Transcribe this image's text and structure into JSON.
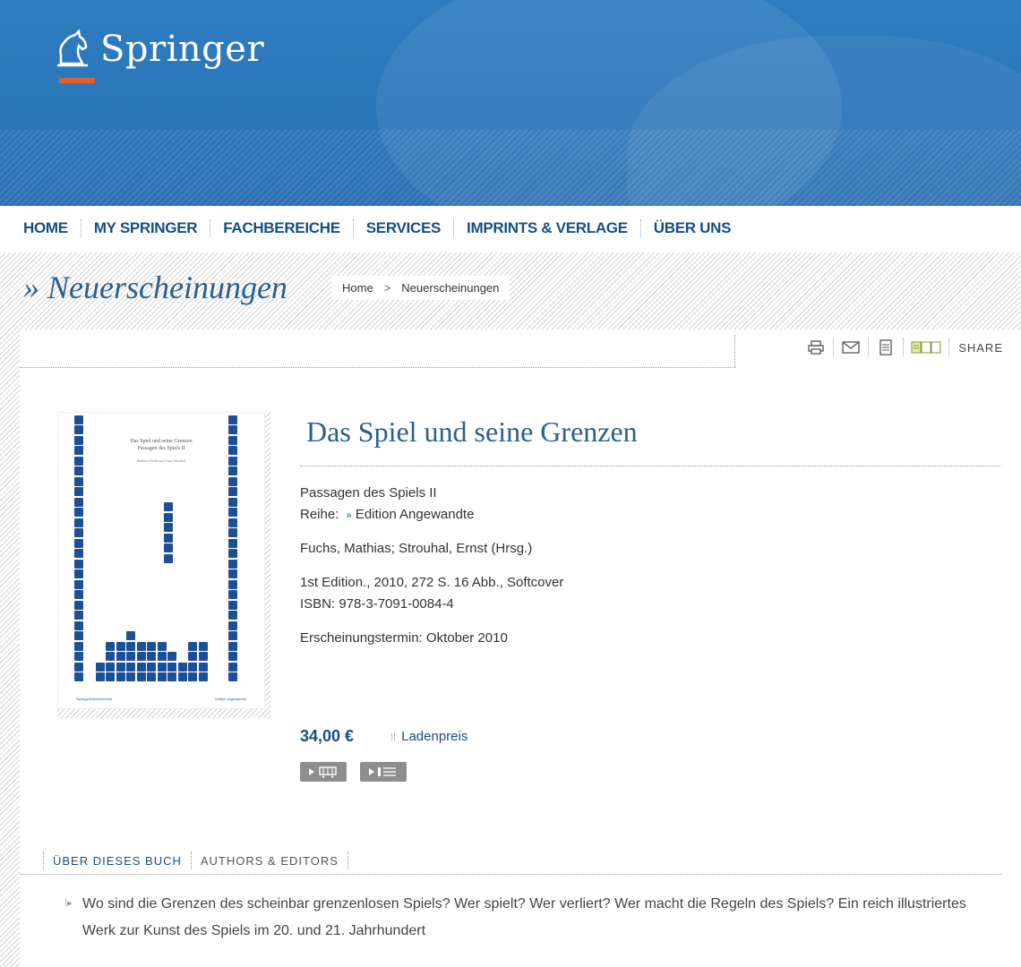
{
  "brand": {
    "name": "Springer"
  },
  "nav": {
    "items": [
      "HOME",
      "MY SPRINGER",
      "FACHBEREICHE",
      "SERVICES",
      "IMPRINTS & VERLAGE",
      "ÜBER UNS"
    ]
  },
  "page": {
    "title": "» Neuerscheinungen"
  },
  "breadcrumb": {
    "home": "Home",
    "separator": ">",
    "current": "Neuerscheinungen"
  },
  "toolbar": {
    "share_label": "SHARE",
    "icons": [
      "print-icon",
      "mail-icon",
      "document-icon",
      "compare-icon"
    ]
  },
  "book": {
    "title": "Das Spiel und seine Grenzen",
    "subtitle": "Passagen des Spiels II",
    "series_label": "Reihe:",
    "series_marker": "»",
    "series": "Edition Angewandte",
    "authors": "Fuchs, Mathias; Strouhal, Ernst (Hrsg.)",
    "edition": "1st Edition., 2010, 272 S. 16 Abb., Softcover",
    "isbn": "ISBN: 978-3-7091-0084-4",
    "release": "Erscheinungstermin: Oktober 2010",
    "price": "34,00 €",
    "price_note": "Ladenpreis",
    "cover": {
      "title_line1": "Das Spiel und seine Grenzen",
      "title_line2": "Passagen des Spiels II",
      "editors": "Mathias Fuchs und Ernst Strouhal",
      "publisher_left": "SpringerWienNewYork",
      "publisher_right": "edition angewandte"
    }
  },
  "tabs": {
    "items": [
      "ÜBER DIESES BUCH",
      "AUTHORS & EDITORS"
    ],
    "active": "ÜBER DIESES BUCH"
  },
  "description": "Wo sind die Grenzen des scheinbar grenzenlosen Spiels? Wer spielt? Wer verliert? Wer macht die Regeln des Spiels? Ein reich illustriertes Werk zur Kunst des Spiels im 20. und 21. Jahrhundert",
  "colors": {
    "banner": "#2c76b9",
    "accent": "#e0622a",
    "link": "#174f85",
    "title": "#2a5f90",
    "square": "#1d4f95"
  }
}
